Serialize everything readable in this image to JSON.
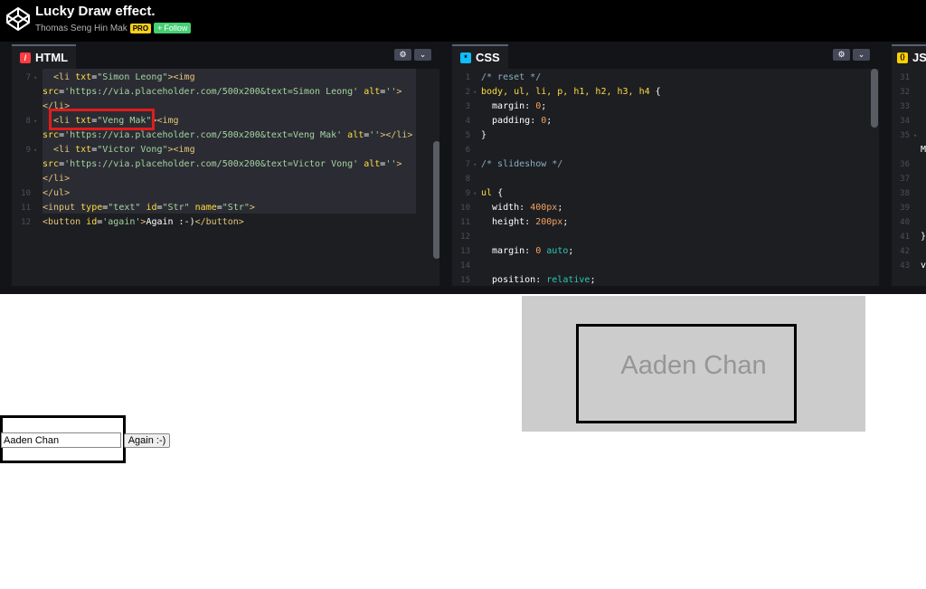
{
  "header": {
    "title": "Lucky Draw effect.",
    "author": "Thomas Seng Hin Mak",
    "badge": "PRO",
    "follow_label": "Follow",
    "follow_symbol": "+"
  },
  "editors": {
    "html": {
      "label": "HTML",
      "icon_symbol": "/",
      "accent": "#ff3c41",
      "lines": [
        {
          "n": "7",
          "fold": "▾",
          "parts": [
            [
              "t-tag",
              "  <li "
            ],
            [
              "t-attr",
              "txt"
            ],
            [
              "t-plain",
              "="
            ],
            [
              "t-str",
              "\"Simon Leong\""
            ],
            [
              "t-tag",
              "><img"
            ]
          ]
        },
        {
          "n": "",
          "fold": "",
          "parts": [
            [
              "t-attr",
              "src"
            ],
            [
              "t-plain",
              "="
            ],
            [
              "t-str",
              "'https://via.placeholder.com/500x200&text=Simon Leong'"
            ],
            [
              "t-plain",
              " "
            ],
            [
              "t-attr",
              "alt"
            ],
            [
              "t-plain",
              "="
            ],
            [
              "t-str",
              "''"
            ],
            [
              "t-tag",
              ">"
            ]
          ]
        },
        {
          "n": "",
          "fold": "",
          "parts": [
            [
              "t-tag",
              "</li>"
            ]
          ]
        },
        {
          "n": "8",
          "fold": "▾",
          "parts": [
            [
              "t-tag",
              "  <li "
            ],
            [
              "t-attr",
              "txt"
            ],
            [
              "t-plain",
              "="
            ],
            [
              "t-str",
              "\"Veng Mak\""
            ],
            [
              "t-tag",
              "><img"
            ]
          ]
        },
        {
          "n": "",
          "fold": "",
          "parts": [
            [
              "t-attr",
              "src"
            ],
            [
              "t-plain",
              "="
            ],
            [
              "t-str",
              "'https://via.placeholder.com/500x200&text=Veng Mak'"
            ],
            [
              "t-plain",
              " "
            ],
            [
              "t-attr",
              "alt"
            ],
            [
              "t-plain",
              "="
            ],
            [
              "t-str",
              "''"
            ],
            [
              "t-tag",
              "></li>"
            ]
          ]
        },
        {
          "n": "9",
          "fold": "▾",
          "parts": [
            [
              "t-tag",
              "  <li "
            ],
            [
              "t-attr",
              "txt"
            ],
            [
              "t-plain",
              "="
            ],
            [
              "t-str",
              "\"Victor Vong\""
            ],
            [
              "t-tag",
              "><img"
            ]
          ]
        },
        {
          "n": "",
          "fold": "",
          "parts": [
            [
              "t-attr",
              "src"
            ],
            [
              "t-plain",
              "="
            ],
            [
              "t-str",
              "'https://via.placeholder.com/500x200&text=Victor Vong'"
            ],
            [
              "t-plain",
              " "
            ],
            [
              "t-attr",
              "alt"
            ],
            [
              "t-plain",
              "="
            ],
            [
              "t-str",
              "''"
            ],
            [
              "t-tag",
              ">"
            ]
          ]
        },
        {
          "n": "",
          "fold": "",
          "parts": [
            [
              "t-tag",
              "</li>"
            ]
          ]
        },
        {
          "n": "10",
          "fold": "",
          "parts": [
            [
              "t-tag",
              "</ul>"
            ]
          ]
        },
        {
          "n": "11",
          "fold": "",
          "parts": [
            [
              "t-tag",
              "<input "
            ],
            [
              "t-attr",
              "type"
            ],
            [
              "t-plain",
              "="
            ],
            [
              "t-str",
              "\"text\""
            ],
            [
              "t-plain",
              " "
            ],
            [
              "t-attr",
              "id"
            ],
            [
              "t-plain",
              "="
            ],
            [
              "t-str",
              "\"Str\""
            ],
            [
              "t-plain",
              " "
            ],
            [
              "t-attr",
              "name"
            ],
            [
              "t-plain",
              "="
            ],
            [
              "t-str",
              "\"Str\""
            ],
            [
              "t-tag",
              ">"
            ]
          ]
        },
        {
          "n": "12",
          "fold": "",
          "parts": [
            [
              "t-tag",
              "<button "
            ],
            [
              "t-attr",
              "id"
            ],
            [
              "t-plain",
              "="
            ],
            [
              "t-str",
              "'again'"
            ],
            [
              "t-tag",
              ">"
            ],
            [
              "t-plain",
              "Again :-)"
            ],
            [
              "t-tag",
              "</button>"
            ]
          ]
        }
      ]
    },
    "css": {
      "label": "CSS",
      "icon_symbol": "*",
      "accent": "#0ebeff",
      "lines": [
        {
          "n": "1",
          "fold": "",
          "parts": [
            [
              "t-comment",
              "/* reset */"
            ]
          ]
        },
        {
          "n": "2",
          "fold": "▾",
          "parts": [
            [
              "t-prop",
              "body, ul, li, p, h1, h2, h3, h4 "
            ],
            [
              "t-plain",
              "{"
            ]
          ]
        },
        {
          "n": "3",
          "fold": "",
          "parts": [
            [
              "t-plain",
              "  margin"
            ],
            [
              "t-plain",
              ": "
            ],
            [
              "t-num",
              "0"
            ],
            [
              "t-plain",
              ";"
            ]
          ]
        },
        {
          "n": "4",
          "fold": "",
          "parts": [
            [
              "t-plain",
              "  padding"
            ],
            [
              "t-plain",
              ": "
            ],
            [
              "t-num",
              "0"
            ],
            [
              "t-plain",
              ";"
            ]
          ]
        },
        {
          "n": "5",
          "fold": "",
          "parts": [
            [
              "t-plain",
              "}"
            ]
          ]
        },
        {
          "n": "6",
          "fold": "",
          "parts": []
        },
        {
          "n": "7",
          "fold": "▾",
          "parts": [
            [
              "t-comment",
              "/* slideshow */"
            ]
          ]
        },
        {
          "n": "8",
          "fold": "",
          "parts": []
        },
        {
          "n": "9",
          "fold": "▾",
          "parts": [
            [
              "t-prop",
              "ul "
            ],
            [
              "t-plain",
              "{"
            ]
          ]
        },
        {
          "n": "10",
          "fold": "",
          "parts": [
            [
              "t-plain",
              "  width"
            ],
            [
              "t-plain",
              ": "
            ],
            [
              "t-num",
              "400px"
            ],
            [
              "t-plain",
              ";"
            ]
          ]
        },
        {
          "n": "11",
          "fold": "",
          "parts": [
            [
              "t-plain",
              "  height"
            ],
            [
              "t-plain",
              ": "
            ],
            [
              "t-num",
              "200px"
            ],
            [
              "t-plain",
              ";"
            ]
          ]
        },
        {
          "n": "12",
          "fold": "",
          "parts": []
        },
        {
          "n": "13",
          "fold": "",
          "parts": [
            [
              "t-plain",
              "  margin"
            ],
            [
              "t-plain",
              ": "
            ],
            [
              "t-num",
              "0"
            ],
            [
              "t-plain",
              " "
            ],
            [
              "t-val",
              "auto"
            ],
            [
              "t-plain",
              ";"
            ]
          ]
        },
        {
          "n": "14",
          "fold": "",
          "parts": []
        },
        {
          "n": "15",
          "fold": "",
          "parts": [
            [
              "t-plain",
              "  position"
            ],
            [
              "t-plain",
              ": "
            ],
            [
              "t-val",
              "relative"
            ],
            [
              "t-plain",
              ";"
            ]
          ]
        }
      ]
    },
    "js": {
      "label": "JS",
      "icon_symbol": "{}",
      "accent": "#fcd000",
      "lines": [
        {
          "n": "31",
          "fold": "",
          "text": ""
        },
        {
          "n": "32",
          "fold": "",
          "text": ""
        },
        {
          "n": "33",
          "fold": "",
          "text": ""
        },
        {
          "n": "34",
          "fold": "",
          "text": ""
        },
        {
          "n": "35",
          "fold": "▾",
          "text": ""
        },
        {
          "n": "",
          "fold": "",
          "text": "M"
        },
        {
          "n": "36",
          "fold": "",
          "text": ""
        },
        {
          "n": "37",
          "fold": "",
          "text": ""
        },
        {
          "n": "38",
          "fold": "",
          "text": ""
        },
        {
          "n": "39",
          "fold": "",
          "text": ""
        },
        {
          "n": "40",
          "fold": "",
          "text": ""
        },
        {
          "n": "41",
          "fold": "",
          "text": "}"
        },
        {
          "n": "42",
          "fold": "",
          "text": ""
        },
        {
          "n": "43",
          "fold": "",
          "text": "v"
        }
      ]
    },
    "settings_icon": "⚙",
    "chevron_icon": "⌄"
  },
  "preview": {
    "slide_text": "Aaden Chan",
    "input_value": "Aaden Chan",
    "again_label": "Again :-)"
  }
}
